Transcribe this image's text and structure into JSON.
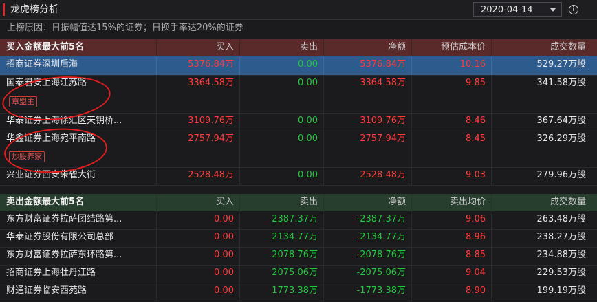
{
  "header": {
    "title": "龙虎榜分析",
    "date": "2020-04-14"
  },
  "reason": "上榜原因：日振幅值达15%的证券；日换手率达20%的证券",
  "buy": {
    "title": "买入金额最大前5名",
    "columns": [
      "买入",
      "卖出",
      "净额",
      "预估成本价",
      "成交数量"
    ],
    "rows": [
      {
        "name": "招商证券深圳后海",
        "buy": "5376.84万",
        "sell": "0.00",
        "net": "5376.84万",
        "price": "10.16",
        "volume": "529.27万股",
        "tag": ""
      },
      {
        "name": "国泰君安上海江苏路",
        "buy": "3364.58万",
        "sell": "0.00",
        "net": "3364.58万",
        "price": "9.85",
        "volume": "341.58万股",
        "tag": "章盟主"
      },
      {
        "name": "华泰证券上海徐汇区天钥桥...",
        "buy": "3109.76万",
        "sell": "0.00",
        "net": "3109.76万",
        "price": "8.46",
        "volume": "367.64万股",
        "tag": ""
      },
      {
        "name": "华鑫证券上海宛平南路",
        "buy": "2757.94万",
        "sell": "0.00",
        "net": "2757.94万",
        "price": "8.45",
        "volume": "326.29万股",
        "tag": "炒股养家"
      },
      {
        "name": "兴业证券西安朱雀大街",
        "buy": "2528.48万",
        "sell": "0.00",
        "net": "2528.48万",
        "price": "9.03",
        "volume": "279.96万股",
        "tag": ""
      }
    ]
  },
  "sell": {
    "title": "卖出金额最大前5名",
    "columns": [
      "买入",
      "卖出",
      "净额",
      "卖出均价",
      "成交数量"
    ],
    "rows": [
      {
        "name": "东方财富证券拉萨团结路第...",
        "buy": "0.00",
        "sell": "2387.37万",
        "net": "-2387.37万",
        "price": "9.06",
        "volume": "263.48万股"
      },
      {
        "name": "华泰证券股份有限公司总部",
        "buy": "0.00",
        "sell": "2134.77万",
        "net": "-2134.77万",
        "price": "8.96",
        "volume": "238.27万股"
      },
      {
        "name": "东方财富证券拉萨东环路第...",
        "buy": "0.00",
        "sell": "2078.76万",
        "net": "-2078.76万",
        "price": "8.85",
        "volume": "234.88万股"
      },
      {
        "name": "招商证券上海牡丹江路",
        "buy": "0.00",
        "sell": "2075.06万",
        "net": "-2075.06万",
        "price": "9.04",
        "volume": "229.53万股"
      },
      {
        "name": "财通证券临安西苑路",
        "buy": "0.00",
        "sell": "1773.38万",
        "net": "-1773.38万",
        "price": "8.90",
        "volume": "199.19万股"
      }
    ]
  },
  "colors": {
    "up": "#ff3b3b",
    "down": "#22c83c",
    "selected": "#2d5b8e",
    "buy_header": "#5a2a2a",
    "sell_header": "#273d2e"
  }
}
